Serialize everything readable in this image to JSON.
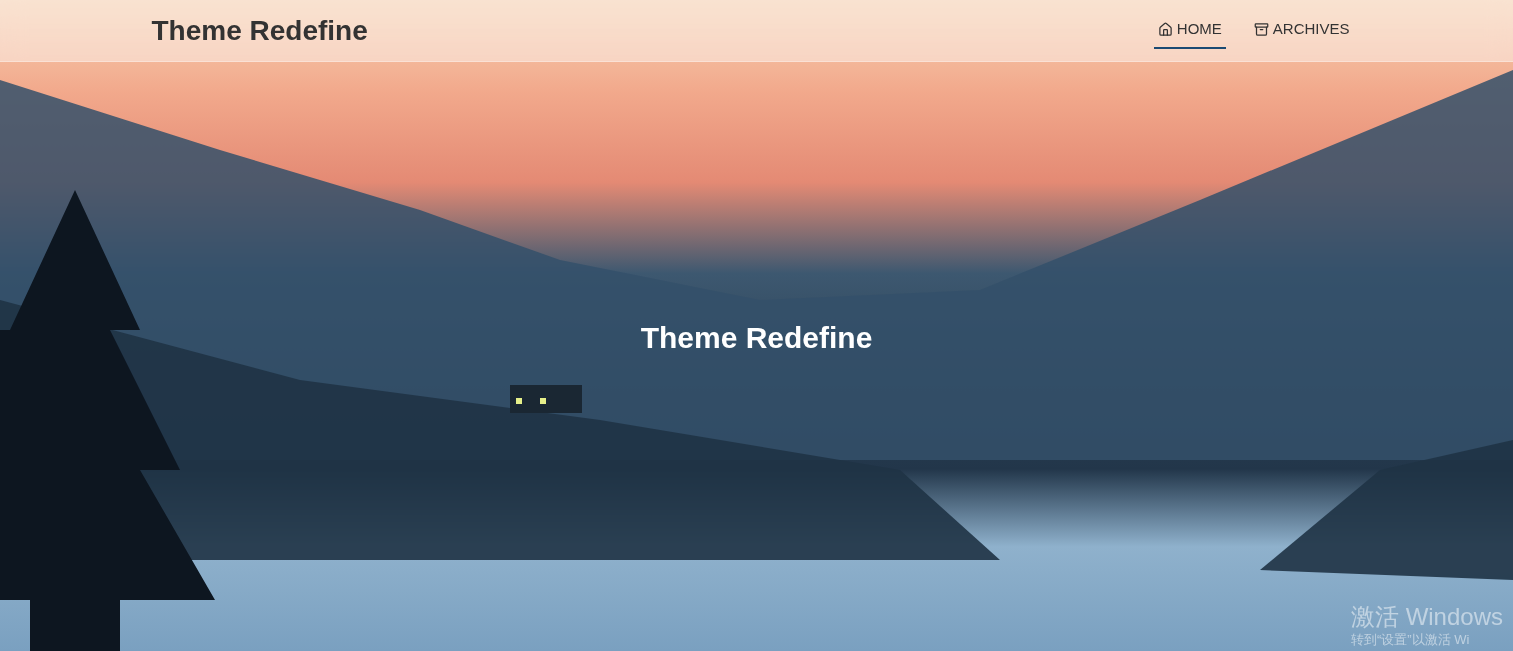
{
  "header": {
    "site_title": "Theme Redefine",
    "nav": [
      {
        "label": "HOME",
        "icon": "home",
        "selected": true
      },
      {
        "label": "ARCHIVES",
        "icon": "archive",
        "selected": false
      }
    ]
  },
  "hero": {
    "title": "Theme Redefine"
  },
  "watermark": {
    "title": "激活 Windows",
    "subtitle": "转到“设置”以激活 Wi"
  }
}
